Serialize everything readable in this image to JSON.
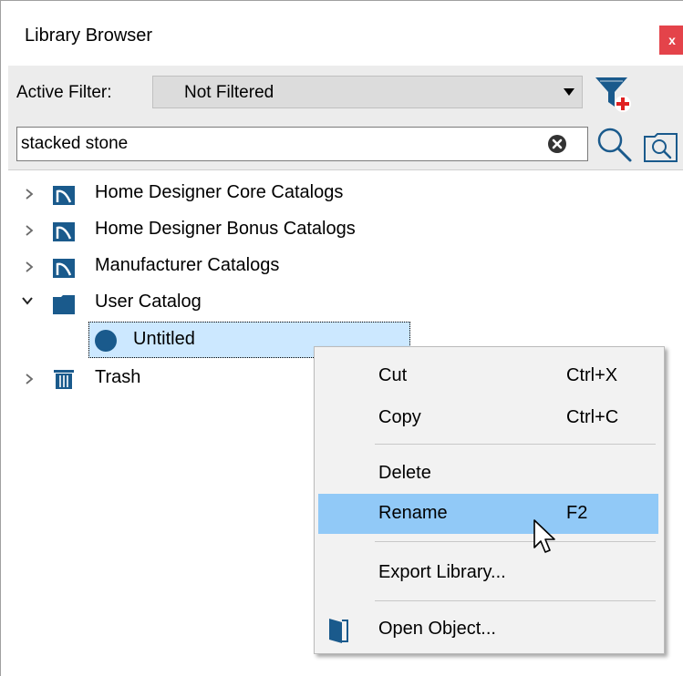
{
  "window": {
    "title": "Library Browser",
    "close_label": "x"
  },
  "filter": {
    "label": "Active Filter:",
    "selected": "Not Filtered"
  },
  "search": {
    "value": "stacked stone"
  },
  "tree": {
    "items": [
      {
        "label": "Home Designer Core Catalogs",
        "icon": "catalog-folder-icon",
        "expanded": false
      },
      {
        "label": "Home Designer Bonus Catalogs",
        "icon": "catalog-folder-icon",
        "expanded": false
      },
      {
        "label": "Manufacturer Catalogs",
        "icon": "catalog-folder-icon",
        "expanded": false
      },
      {
        "label": "User Catalog",
        "icon": "folder-icon",
        "expanded": true
      },
      {
        "label": "Untitled",
        "icon": "circle-icon",
        "selected": true
      },
      {
        "label": "Trash",
        "icon": "trash-icon",
        "expanded": false
      }
    ]
  },
  "context_menu": {
    "items": [
      {
        "label": "Cut",
        "shortcut": "Ctrl+X"
      },
      {
        "label": "Copy",
        "shortcut": "Ctrl+C"
      },
      {
        "label": "Delete",
        "shortcut": ""
      },
      {
        "label": "Rename",
        "shortcut": "F2",
        "highlighted": true
      },
      {
        "label": "Export Library...",
        "shortcut": ""
      },
      {
        "label": "Open Object...",
        "shortcut": "",
        "icon": "open-object-icon"
      }
    ]
  },
  "colors": {
    "accent": "#1a5a8c",
    "selection": "#cce8ff",
    "menu_highlight": "#91c9f7",
    "close": "#e4434a"
  }
}
